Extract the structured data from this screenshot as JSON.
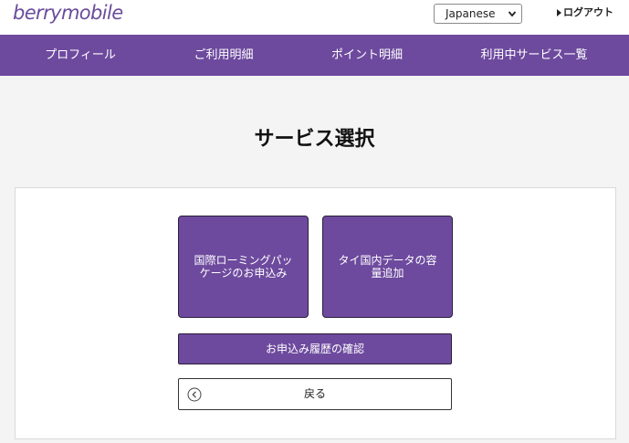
{
  "header": {
    "logo_text": "berrymobile",
    "language_selected": "Japanese",
    "logout_label": "ログアウト"
  },
  "nav": {
    "items": [
      {
        "label": "プロフィール"
      },
      {
        "label": "ご利用明細"
      },
      {
        "label": "ポイント明細"
      },
      {
        "label": "利用中サービス一覧"
      }
    ]
  },
  "main": {
    "title": "サービス選択",
    "tiles": [
      {
        "label": "国際ローミングパッケージのお申込み"
      },
      {
        "label": "タイ国内データの容量追加"
      }
    ],
    "history_button": "お申込み履歴の確認",
    "back_button": "戻る"
  },
  "colors": {
    "brand": "#6d4a9e",
    "logo": "#6a4c9c",
    "background": "#f4f4f4"
  }
}
